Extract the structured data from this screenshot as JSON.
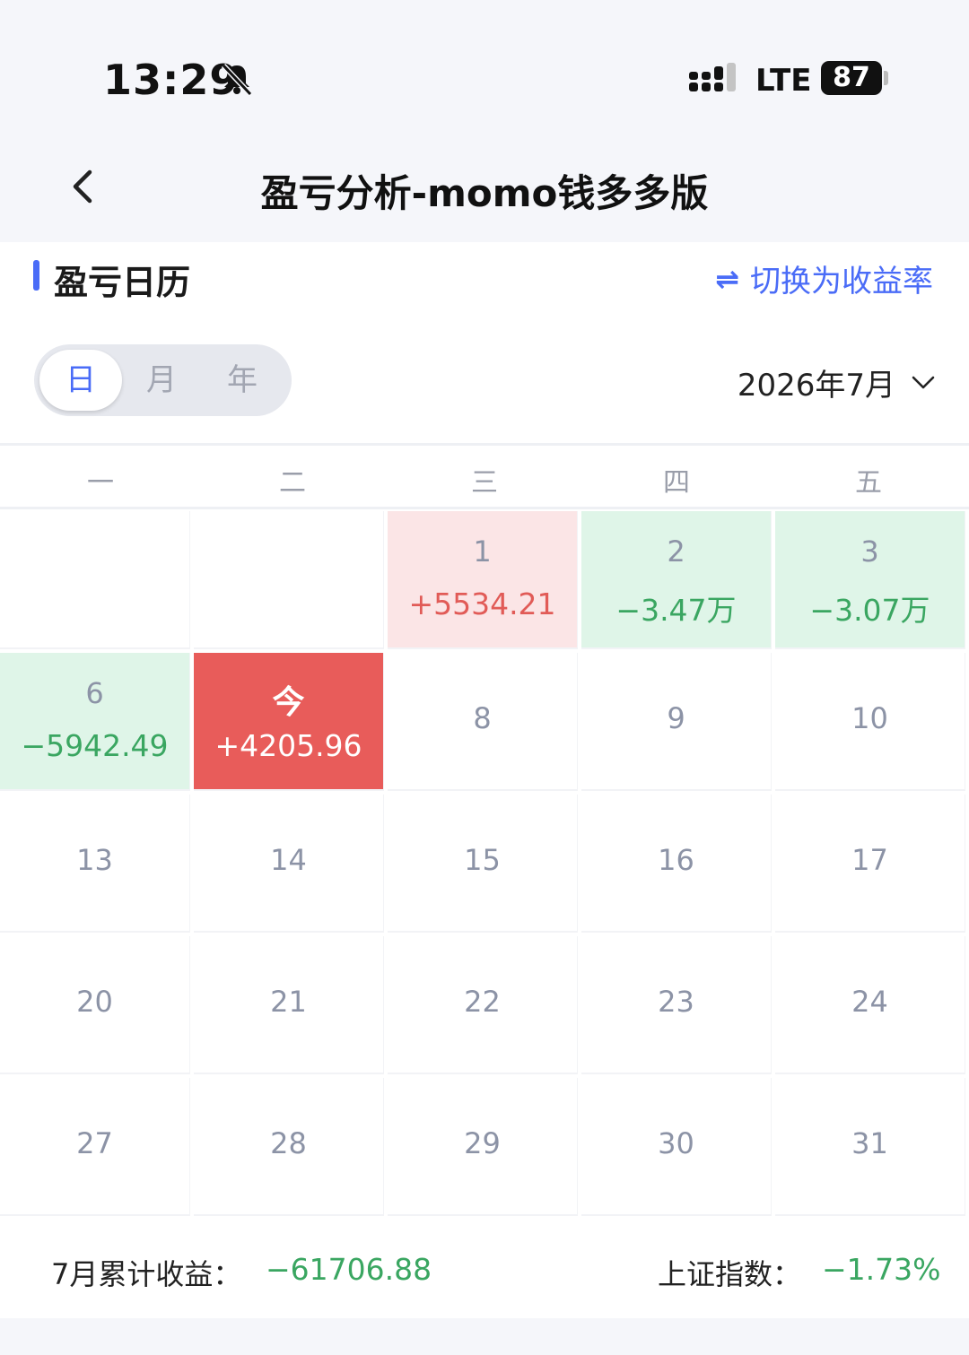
{
  "status_bar": {
    "time": "13:29",
    "network": "LTE",
    "battery": "87"
  },
  "nav": {
    "title": "盈亏分析-momo钱多多版"
  },
  "section": {
    "title": "盈亏日历",
    "switch_label": "切换为收益率"
  },
  "segmented": {
    "day": "日",
    "month": "月",
    "year": "年",
    "selected": "day"
  },
  "month_picker": {
    "label": "2026年7月"
  },
  "weekdays": [
    "一",
    "二",
    "三",
    "四",
    "五"
  ],
  "calendar": {
    "rows": [
      [
        {
          "day": "",
          "pnl": ""
        },
        {
          "day": "",
          "pnl": ""
        },
        {
          "day": "1",
          "pnl": "+5534.21",
          "state": "up"
        },
        {
          "day": "2",
          "pnl": "−3.47万",
          "state": "down"
        },
        {
          "day": "3",
          "pnl": "−3.07万",
          "state": "down"
        }
      ],
      [
        {
          "day": "6",
          "pnl": "−5942.49",
          "state": "down"
        },
        {
          "day": "今",
          "pnl": "+4205.96",
          "state": "today"
        },
        {
          "day": "8"
        },
        {
          "day": "9"
        },
        {
          "day": "10"
        }
      ],
      [
        {
          "day": "13"
        },
        {
          "day": "14"
        },
        {
          "day": "15"
        },
        {
          "day": "16"
        },
        {
          "day": "17"
        }
      ],
      [
        {
          "day": "20"
        },
        {
          "day": "21"
        },
        {
          "day": "22"
        },
        {
          "day": "23"
        },
        {
          "day": "24"
        }
      ],
      [
        {
          "day": "27"
        },
        {
          "day": "28"
        },
        {
          "day": "29"
        },
        {
          "day": "30"
        },
        {
          "day": "31"
        }
      ]
    ]
  },
  "summary": {
    "month_label": "7月累计收益：",
    "month_value": "−61706.88",
    "index_label": "上证指数：",
    "index_value": "−1.73%"
  },
  "colors": {
    "accent": "#4a6cf7",
    "gain": "#e15b57",
    "loss": "#3aa661",
    "today": "#e85c5a"
  }
}
